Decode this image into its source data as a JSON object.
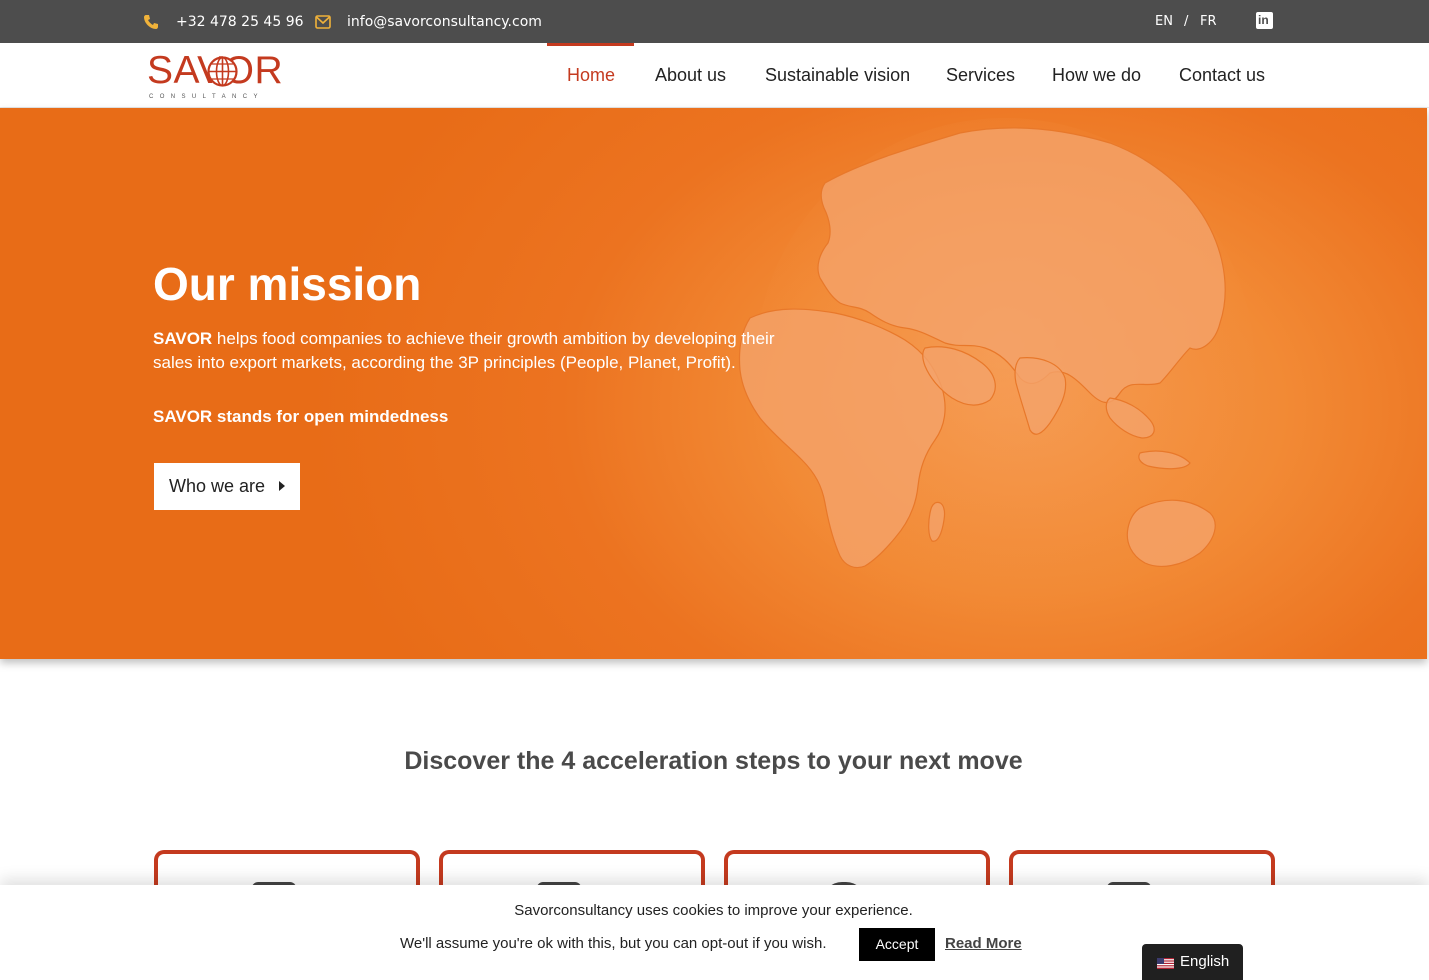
{
  "topbar": {
    "phone": "+32 478 25 45 96",
    "email": "info@savorconsultancy.com",
    "lang_en": "EN",
    "lang_sep": "/",
    "lang_fr": "FR",
    "linkedin_icon": "linkedin-icon"
  },
  "logo": {
    "name": "SAVOR",
    "sub": "CONSULTANCY"
  },
  "nav": {
    "items": [
      {
        "label": "Home",
        "active": true
      },
      {
        "label": "About us",
        "active": false
      },
      {
        "label": "Sustainable vision",
        "active": false
      },
      {
        "label": "Services",
        "active": false
      },
      {
        "label": "How we do",
        "active": false
      },
      {
        "label": "Contact us",
        "active": false
      }
    ]
  },
  "hero": {
    "title": "Our mission",
    "brand": "SAVOR",
    "text": " helps food companies to achieve their growth ambition by developing their sales into export markets, according the 3P principles (People, Planet, Profit).",
    "tagline": "SAVOR stands for open mindedness",
    "button": "Who we are"
  },
  "steps": {
    "title": "Discover the 4 acceleration steps to your next move"
  },
  "cookie": {
    "line1": "Savorconsultancy uses cookies to improve your experience.",
    "line2": "We'll assume you're ok with this, but you can opt-out if you wish.",
    "accept": "Accept",
    "read_more": "Read More"
  },
  "language_switcher": {
    "label": "English",
    "flag_icon": "us-flag-icon"
  },
  "colors": {
    "brand_red": "#c43a1f",
    "hero_orange": "#ec7320",
    "topbar": "#4d4d4d",
    "icon_yellow": "#f0b23a"
  }
}
